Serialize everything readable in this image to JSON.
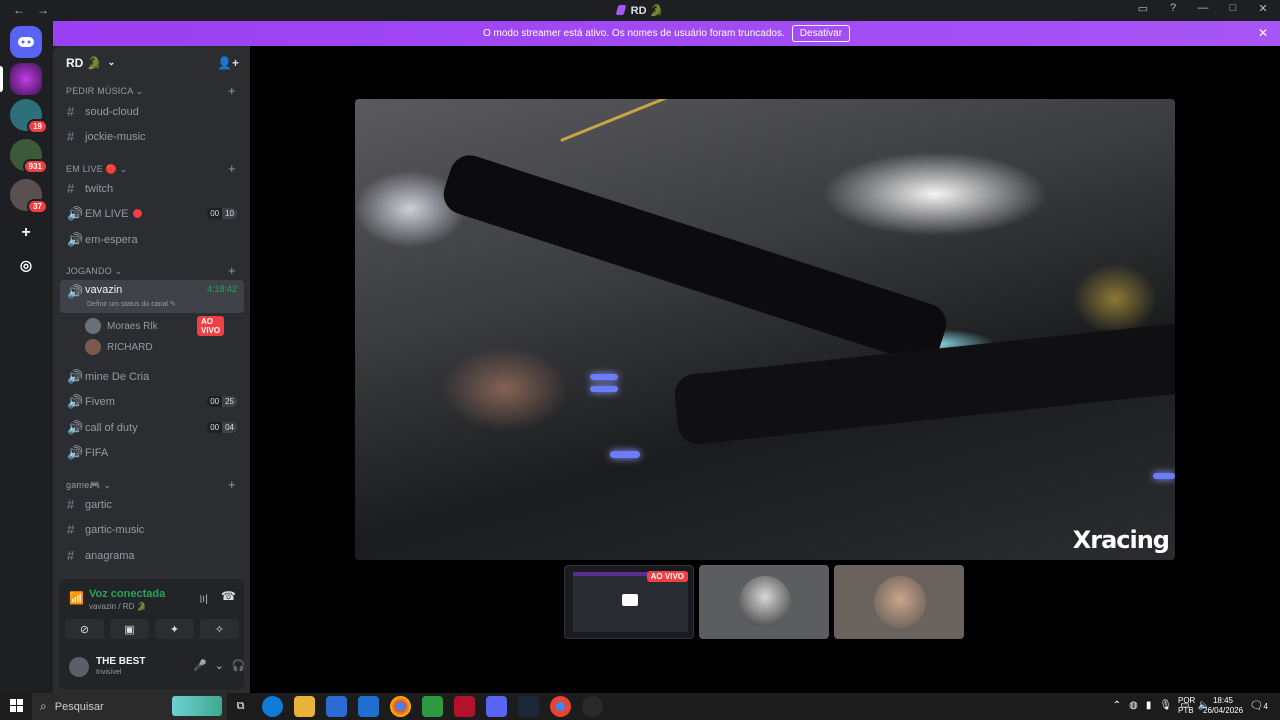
{
  "titlebar": {
    "back": "←",
    "forward": "→",
    "title": "RD 🐊",
    "inbox_icon": "▭",
    "help_icon": "?",
    "minimize": "—",
    "maximize": "□",
    "close": "✕"
  },
  "rail": {
    "badges": [
      "19",
      "931",
      "37"
    ],
    "add_icon": "+",
    "discover_icon": "◎"
  },
  "banner": {
    "text": "O modo streamer está ativo. Os nomes de usuário foram truncados.",
    "button": "Desativar",
    "close": "✕"
  },
  "server": {
    "name": "RD 🐊",
    "chevron": "⌄",
    "invite_icon": "👤+"
  },
  "categories": [
    {
      "name": "PEDIR MÚSICA ⌄"
    },
    {
      "name": "EM LIVE 🔴 ⌄"
    },
    {
      "name": "JOGANDO ⌄"
    },
    {
      "name": "game🎮 ⌄"
    }
  ],
  "channels": {
    "soud_cloud": "soud-cloud",
    "jockie_music": "jockie-music",
    "twitch": "twitch",
    "em_live": "EM LIVE",
    "em_live_counts": [
      "00",
      "10"
    ],
    "em_espera": "em-espera",
    "vavazin": "vavazin",
    "vavazin_timer": "4:18:42",
    "vavazin_status": "Definir um status do canal ✎",
    "mine_de_cria": "mine De Cria",
    "fivem": "Fivem",
    "fivem_counts": [
      "00",
      "25"
    ],
    "call_of_duty": "call of duty",
    "cod_counts": [
      "00",
      "04"
    ],
    "fifa": "FIFA",
    "gartic": "gartic",
    "gartic_music": "gartic-music",
    "anagrama": "anagrama"
  },
  "members": [
    {
      "name": "Moraes Rlk",
      "badge": "AO VIVO"
    },
    {
      "name": "RICHARD"
    }
  ],
  "voice": {
    "title": "Voz conectada",
    "subtitle": "vavazin / RD 🐊"
  },
  "user": {
    "name": "THE BEST",
    "status": "Invisível"
  },
  "stream": {
    "logo": "Xracing",
    "thumb_badge": "AO VIVO"
  },
  "taskbar": {
    "search_placeholder": "Pesquisar",
    "lang_top": "POR",
    "lang_bottom": "PTB",
    "time": "18:45",
    "date": "26/04/2026",
    "notif_count": "4"
  }
}
